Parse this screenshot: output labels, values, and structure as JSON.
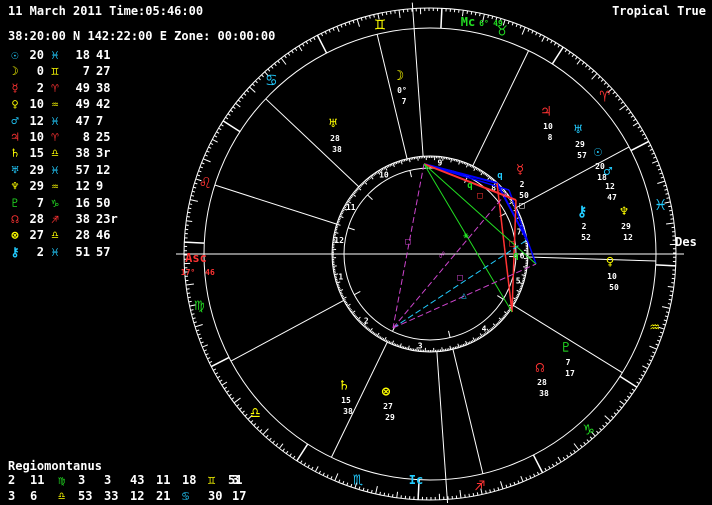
{
  "header": {
    "date_time": "11 March 2011 Time:05:46:00",
    "system": "Tropical True",
    "location": "38:20:00 N 142:22:00 E Zone:  00:00:00"
  },
  "planets": [
    {
      "glyph": "☉",
      "color": "#22ccff",
      "deg": "20",
      "sign": "♓",
      "sign_color": "#22ccff",
      "min": "18",
      "sec": "41",
      "extra": ""
    },
    {
      "glyph": "☽",
      "color": "#ffff00",
      "deg": "0",
      "sign": "♊",
      "sign_color": "#ffff00",
      "min": "7",
      "sec": "27",
      "extra": ""
    },
    {
      "glyph": "☿",
      "color": "#ff3333",
      "deg": "2",
      "sign": "♈",
      "sign_color": "#ff3333",
      "min": "49",
      "sec": "38",
      "extra": ""
    },
    {
      "glyph": "♀",
      "color": "#ffff00",
      "deg": "10",
      "sign": "♒",
      "sign_color": "#ffff00",
      "min": "49",
      "sec": "42",
      "extra": ""
    },
    {
      "glyph": "♂",
      "color": "#22ccff",
      "deg": "12",
      "sign": "♓",
      "sign_color": "#22ccff",
      "min": "47",
      "sec": "7",
      "extra": ""
    },
    {
      "glyph": "♃",
      "color": "#ff3333",
      "deg": "10",
      "sign": "♈",
      "sign_color": "#ff3333",
      "min": "8",
      "sec": "25",
      "extra": ""
    },
    {
      "glyph": "♄",
      "color": "#ffff00",
      "deg": "15",
      "sign": "♎",
      "sign_color": "#ffff00",
      "min": "38",
      "sec": "3",
      "extra": "r"
    },
    {
      "glyph": "♅",
      "color": "#22ccff",
      "deg": "29",
      "sign": "♓",
      "sign_color": "#22ccff",
      "min": "57",
      "sec": "12",
      "extra": ""
    },
    {
      "glyph": "♆",
      "color": "#ffff00",
      "deg": "29",
      "sign": "♒",
      "sign_color": "#ffff00",
      "min": "12",
      "sec": "9",
      "extra": ""
    },
    {
      "glyph": "♇",
      "color": "#22dd22",
      "deg": "7",
      "sign": "♑",
      "sign_color": "#22dd22",
      "min": "16",
      "sec": "50",
      "extra": ""
    },
    {
      "glyph": "☊",
      "color": "#ff3333",
      "deg": "28",
      "sign": "♐",
      "sign_color": "#ff3333",
      "min": "38",
      "sec": "23",
      "extra": "r"
    },
    {
      "glyph": "⊗",
      "color": "#ffff00",
      "deg": "27",
      "sign": "♎",
      "sign_color": "#ffff00",
      "min": "28",
      "sec": "46",
      "extra": ""
    },
    {
      "glyph": "⚷",
      "color": "#22ccff",
      "deg": "2",
      "sign": "♓",
      "sign_color": "#22ccff",
      "min": "51",
      "sec": "57",
      "extra": ""
    }
  ],
  "houses": {
    "system_label": "Regiomontanus",
    "rows": [
      [
        {
          "num": "2",
          "deg": "11",
          "sign": "♍",
          "sign_color": "#22dd22",
          "min": "3"
        },
        {
          "num": "3",
          "deg": "43",
          "sign": "",
          "sign_color": "#22dd22",
          "min": ""
        },
        {
          "num": "11",
          "deg": "18",
          "sign": "♊",
          "sign_color": "#ffff00",
          "min": "3"
        },
        {
          "num": "51",
          "deg": "",
          "sign": "",
          "sign_color": "",
          "min": ""
        }
      ],
      [
        {
          "num": "3",
          "deg": "6",
          "sign": "♎",
          "sign_color": "#ffff00",
          "min": "53"
        },
        {
          "num": "33",
          "deg": "",
          "sign": "",
          "sign_color": "",
          "min": ""
        },
        {
          "num": "12",
          "deg": "21",
          "sign": "♋",
          "sign_color": "#22ccff",
          "min": "30"
        },
        {
          "num": "17",
          "deg": "",
          "sign": "",
          "sign_color": "",
          "min": ""
        }
      ]
    ]
  },
  "wheel": {
    "angle_labels": {
      "mc": "Mc",
      "mc_deg": "6°",
      "mc_min": "49",
      "asc": "Asc",
      "asc_deg": "17°",
      "asc_min": "46",
      "des": "Des",
      "ic": "Ic"
    },
    "zodiac_signs": [
      {
        "glyph": "♉",
        "color": "#22dd22",
        "name": "taurus"
      },
      {
        "glyph": "♊",
        "color": "#ffff00",
        "name": "gemini"
      },
      {
        "glyph": "♋",
        "color": "#22ccff",
        "name": "cancer"
      },
      {
        "glyph": "♌",
        "color": "#ff3333",
        "name": "leo"
      },
      {
        "glyph": "♍",
        "color": "#22dd22",
        "name": "virgo"
      },
      {
        "glyph": "♎",
        "color": "#ffff00",
        "name": "libra"
      },
      {
        "glyph": "♏",
        "color": "#22ccff",
        "name": "scorpio"
      },
      {
        "glyph": "♐",
        "color": "#ff3333",
        "name": "sagittarius"
      },
      {
        "glyph": "♑",
        "color": "#22dd22",
        "name": "capricorn"
      },
      {
        "glyph": "♒",
        "color": "#ffff00",
        "name": "aquarius"
      },
      {
        "glyph": "♓",
        "color": "#22ccff",
        "name": "pisces"
      },
      {
        "glyph": "♈",
        "color": "#ff3333",
        "name": "aries"
      }
    ],
    "house_numbers": [
      "1",
      "2",
      "3",
      "4",
      "5",
      "6",
      "7",
      "8",
      "9",
      "10",
      "11",
      "12"
    ],
    "planet_labels": [
      {
        "glyph": "☽",
        "color": "#ffff00",
        "deg": "0°",
        "min": "7"
      },
      {
        "glyph": "☿",
        "color": "#ff3333",
        "deg": "2",
        "min": "50"
      },
      {
        "glyph": "♃",
        "color": "#ff3333",
        "deg": "10",
        "min": "8"
      },
      {
        "glyph": "♅",
        "color": "#22ccff",
        "deg": "29",
        "min": "57"
      },
      {
        "glyph": "☉",
        "color": "#22ccff",
        "deg": "20",
        "min": "18"
      },
      {
        "glyph": "♂",
        "color": "#22ccff",
        "deg": "12",
        "min": "47"
      },
      {
        "glyph": "⚷",
        "color": "#22ccff",
        "deg": "2",
        "min": "52"
      },
      {
        "glyph": "♆",
        "color": "#ffff00",
        "deg": "29",
        "min": "12"
      },
      {
        "glyph": "♀",
        "color": "#ffff00",
        "deg": "10",
        "min": "50"
      },
      {
        "glyph": "♇",
        "color": "#22dd22",
        "deg": "7",
        "min": "17"
      },
      {
        "glyph": "☊",
        "color": "#ff3333",
        "deg": "28",
        "min": "38"
      },
      {
        "glyph": "⊗",
        "color": "#ffff00",
        "deg": "27",
        "min": "29"
      },
      {
        "glyph": "♄",
        "color": "#ffff00",
        "deg": "15",
        "min": "38"
      },
      {
        "glyph": "♅",
        "color": "#ffff00",
        "deg": "28",
        "min": "38"
      }
    ],
    "aspect_symbols": [
      "q",
      "q",
      "q",
      "□",
      "□",
      "□",
      "□",
      "△",
      "△",
      "⚹",
      "☍"
    ]
  }
}
